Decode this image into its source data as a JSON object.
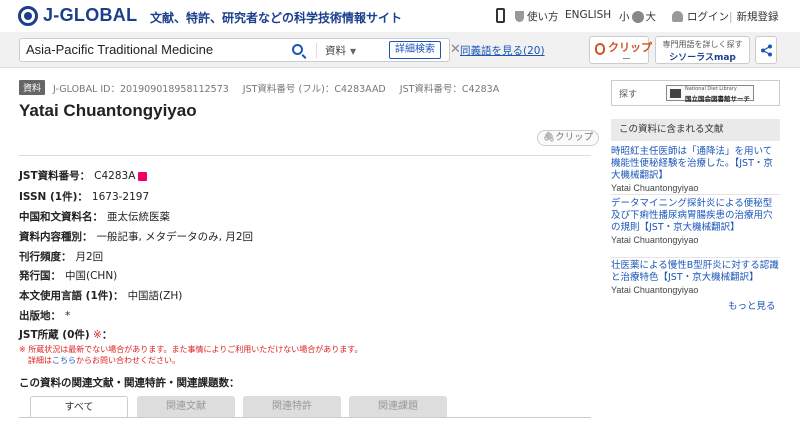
{
  "header": {
    "logo": "J-GLOBAL",
    "tagline": "文献、特許、研究者などの科学技術情報サイト",
    "usage": "使い方",
    "english": "ENGLISH",
    "font_small": "小",
    "font_large": "大",
    "login": "ログイン",
    "register": "新規登録"
  },
  "search": {
    "query": "Asia-Pacific Traditional Medicine",
    "category": "資料",
    "detail_button": "詳細検索",
    "synonym_link": "同義語を見る(20)"
  },
  "tools": {
    "clip_label": "クリップ",
    "clip_sub": "ー",
    "thesaurus_line1": "専門用語を詳しく探す",
    "thesaurus_line2": "シソーラスmap"
  },
  "record": {
    "badge": "資料",
    "jglobal_id": "J-GLOBAL ID：201909018958112573",
    "jst_full": "JST資料番号 (フル)：C4283AAD",
    "jst_short": "JST資料番号：C4283A",
    "title": "Yatai Chuantongyiyao",
    "clip_button": "クリップ"
  },
  "fields": [
    {
      "label": "JST資料番号：",
      "value": "C4283A"
    },
    {
      "label": "ISSN (1件)：",
      "value": "1673-2197"
    },
    {
      "label": "中国和文資料名：",
      "value": "亜太伝統医薬"
    },
    {
      "label": "資料内容種別：",
      "value": "一般記事, メタデータのみ, 月2回"
    },
    {
      "label": "刊行頻度：",
      "value": "月2回"
    },
    {
      "label": "発行国：",
      "value": "中国(CHN)"
    },
    {
      "label": "本文使用言語 (1件)：",
      "value": "中国語(ZH)"
    },
    {
      "label": "出版地：",
      "value": "*"
    },
    {
      "label": "JST所蔵 (0件)",
      "value": "：",
      "mark": "※"
    }
  ],
  "notes": {
    "line1": "※ 所蔵状況は最新でない場合があります。また事情によりご利用いただけない場合があります。",
    "line2_pre": "詳細は",
    "line2_link": "こちら",
    "line2_post": "からお問い合わせください。"
  },
  "related": {
    "heading": "この資料の関連文献・関連特許・関連課題数：",
    "tabs": [
      "すべて",
      "関連文献",
      "関連特許",
      "関連課題"
    ]
  },
  "sidebar": {
    "ndl_label": "探す",
    "ndl_logo_line1": "National Diet Library",
    "ndl_logo_line2": "国立国会図書館サーチ",
    "section_title": "この資料に含まれる文献",
    "items": [
      {
        "title": "時昭紅主任医師は「通降法」を用いて機能性便秘経験を治療した。【JST・京大機械翻訳】",
        "source": "Yatai Chuantongyiyao"
      },
      {
        "title": "データマイニング探針炎による便秘型及び下痢性播尿病胃腸疾患の治療用穴の規則【JST・京大機械翻訳】",
        "source": "Yatai Chuantongyiyao"
      },
      {
        "title": "壮医薬による慢性B型肝炎に対する認識と治療特色【JST・京大機械翻訳】",
        "source": "Yatai Chuantongyiyao"
      }
    ],
    "more": "もっと見る"
  },
  "colors": {
    "brand": "#1b3f8c",
    "link": "#1b56b8",
    "warning": "#dd2222"
  }
}
